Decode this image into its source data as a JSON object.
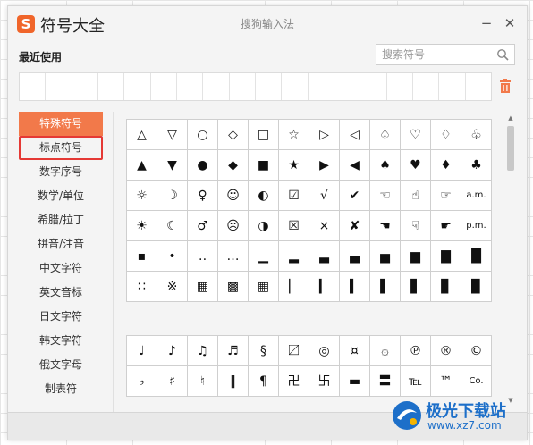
{
  "app": {
    "logo_letter": "S",
    "title": "符号大全",
    "ime_name": "搜狗输入法",
    "minimize_glyph": "−",
    "close_glyph": "✕"
  },
  "recent": {
    "label": "最近使用",
    "cells": 18
  },
  "search": {
    "placeholder": "搜索符号",
    "value": ""
  },
  "categories": [
    {
      "label": "特殊符号",
      "active": true
    },
    {
      "label": "标点符号",
      "highlighted": true
    },
    {
      "label": "数字序号"
    },
    {
      "label": "数学/单位"
    },
    {
      "label": "希腊/拉丁"
    },
    {
      "label": "拼音/注音"
    },
    {
      "label": "中文字符"
    },
    {
      "label": "英文音标"
    },
    {
      "label": "日文字符"
    },
    {
      "label": "韩文字符"
    },
    {
      "label": "俄文字母"
    },
    {
      "label": "制表符"
    }
  ],
  "symbols_a": [
    [
      "△",
      "▽",
      "○",
      "◇",
      "□",
      "☆",
      "▷",
      "◁",
      "♤",
      "♡",
      "♢",
      "♧"
    ],
    [
      "▲",
      "▼",
      "●",
      "◆",
      "■",
      "★",
      "▶",
      "◀",
      "♠",
      "♥",
      "♦",
      "♣"
    ],
    [
      "☼",
      "☽",
      "♀",
      "☺",
      "◐",
      "☑",
      "√",
      "✔",
      "☜",
      "☝",
      "☞",
      "a.m."
    ],
    [
      "☀",
      "☾",
      "♂",
      "☹",
      "◑",
      "☒",
      "×",
      "✘",
      "☚",
      "☟",
      "☛",
      "p.m."
    ],
    [
      "▪",
      "•",
      "‥",
      "…",
      "▁",
      "▂",
      "▃",
      "▄",
      "▅",
      "▆",
      "▇",
      "█"
    ],
    [
      "∷",
      "※",
      "▦",
      "▩",
      "▦",
      "▏",
      "▎",
      "▍",
      "▌",
      "▋",
      "▊",
      "▉"
    ]
  ],
  "symbols_b": [
    [
      "♩",
      "♪",
      "♫",
      "♬",
      "§",
      "〼",
      "◎",
      "¤",
      "۞",
      "℗",
      "®",
      "©"
    ],
    [
      "♭",
      "♯",
      "♮",
      "‖",
      "¶",
      "卍",
      "卐",
      "▬",
      "〓",
      "℡",
      "™",
      "Co."
    ]
  ],
  "watermark": {
    "text": "极光下载站",
    "url": "www.xz7.com"
  },
  "colors": {
    "accent": "#f2794a",
    "highlight_border": "#e53935",
    "logo": "#f0652a"
  }
}
